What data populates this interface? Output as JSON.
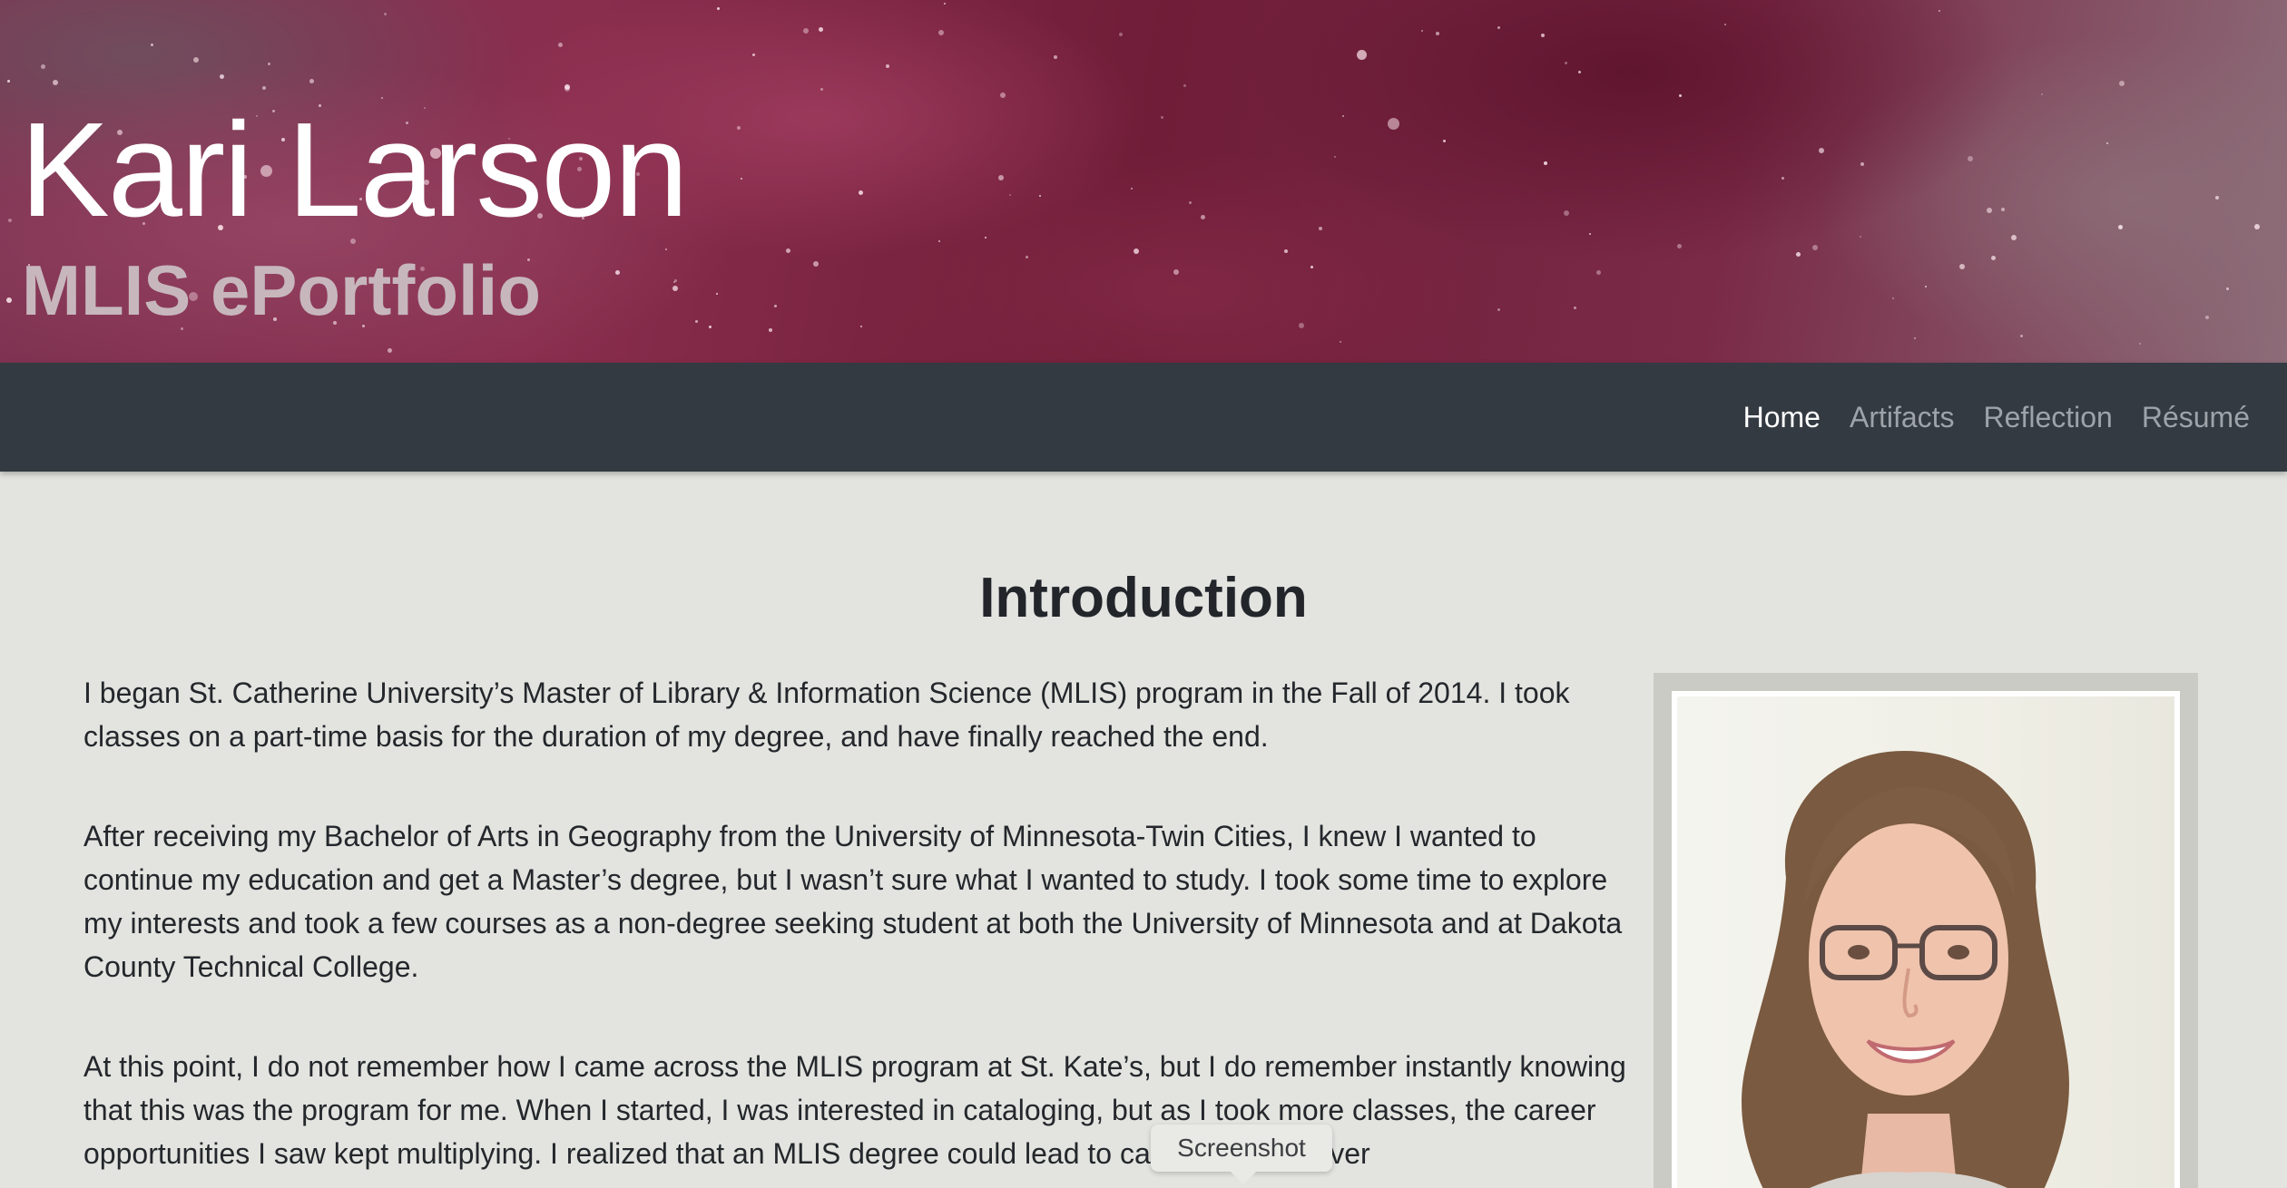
{
  "header": {
    "title": "Kari Larson",
    "subtitle": "MLIS ePortfolio"
  },
  "nav": {
    "items": [
      {
        "label": "Home",
        "active": true
      },
      {
        "label": "Artifacts",
        "active": false
      },
      {
        "label": "Reflection",
        "active": false
      },
      {
        "label": "Résumé",
        "active": false
      }
    ]
  },
  "main": {
    "heading": "Introduction",
    "paragraphs": [
      "I began St. Catherine University’s Master of Library & Information Science (MLIS) program in the Fall of 2014. I took classes on a part-time basis for the duration of my degree, and have finally reached the end.",
      "After receiving my Bachelor of Arts in Geography from the University of Minnesota-Twin Cities, I knew I wanted to continue my education and get a Master’s degree, but I wasn’t sure what I wanted to study. I took some time to explore my interests and took a few courses as a non-degree seeking student at both the University of Minnesota and at Dakota County Technical College.",
      "At this point, I do not remember how I came across the MLIS program at St. Kate’s, but I do remember instantly knowing that this was the program for me. When I started, I was interested in cataloging, but as I took more classes, the career opportunities I saw kept multiplying. I realized that an MLIS degree could lead to careers I had never"
    ]
  },
  "tooltip": {
    "label": "Screenshot"
  },
  "colors": {
    "banner": "#7e3352",
    "navbar": "#343a41",
    "page_background": "#e3e4e0",
    "nav_active": "#ffffff",
    "nav_inactive": "#9da3a9"
  }
}
